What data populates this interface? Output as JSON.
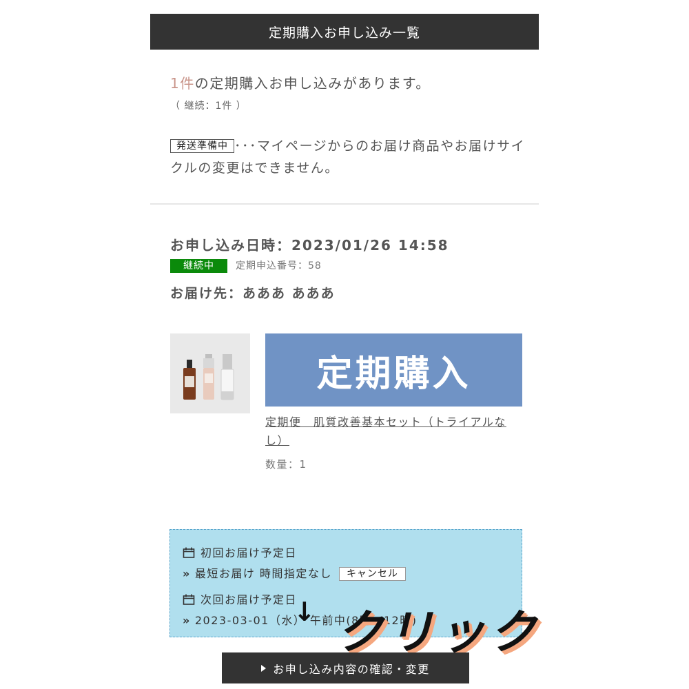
{
  "header": {
    "title": "定期購入お申し込み一覧"
  },
  "summary": {
    "count": "1件",
    "count_suffix": "の定期購入お申し込みがあります。",
    "breakdown": "（ 継続：1件 ）"
  },
  "note": {
    "badge": "発送準備中",
    "text": "･･･マイページからのお届け商品やお届けサイクルの変更はできません。"
  },
  "order": {
    "date_line": "お申し込み日時：2023/01/26 14:58",
    "status": "継続中",
    "status_color": "#0b8a0b",
    "number": "定期申込番号：58",
    "recipient": "お届け先：あああ あああ"
  },
  "product": {
    "banner_text": "定期購入",
    "banner_color": "#7093c5",
    "name": "定期便　肌質改善基本セット（トライアルなし）",
    "quantity": "数量：1"
  },
  "delivery": {
    "first_label": "初回お届け予定日",
    "first_value": "最短お届け 時間指定なし",
    "cancel_label": "キャンセル",
    "next_label": "次回お届け予定日",
    "next_value": "2023-03-01（水） 午前中(8時〜12時)"
  },
  "overlay": {
    "arrow": "↓",
    "text": "クリック"
  },
  "confirm_button": {
    "label": "お申し込み内容の確認・変更"
  }
}
